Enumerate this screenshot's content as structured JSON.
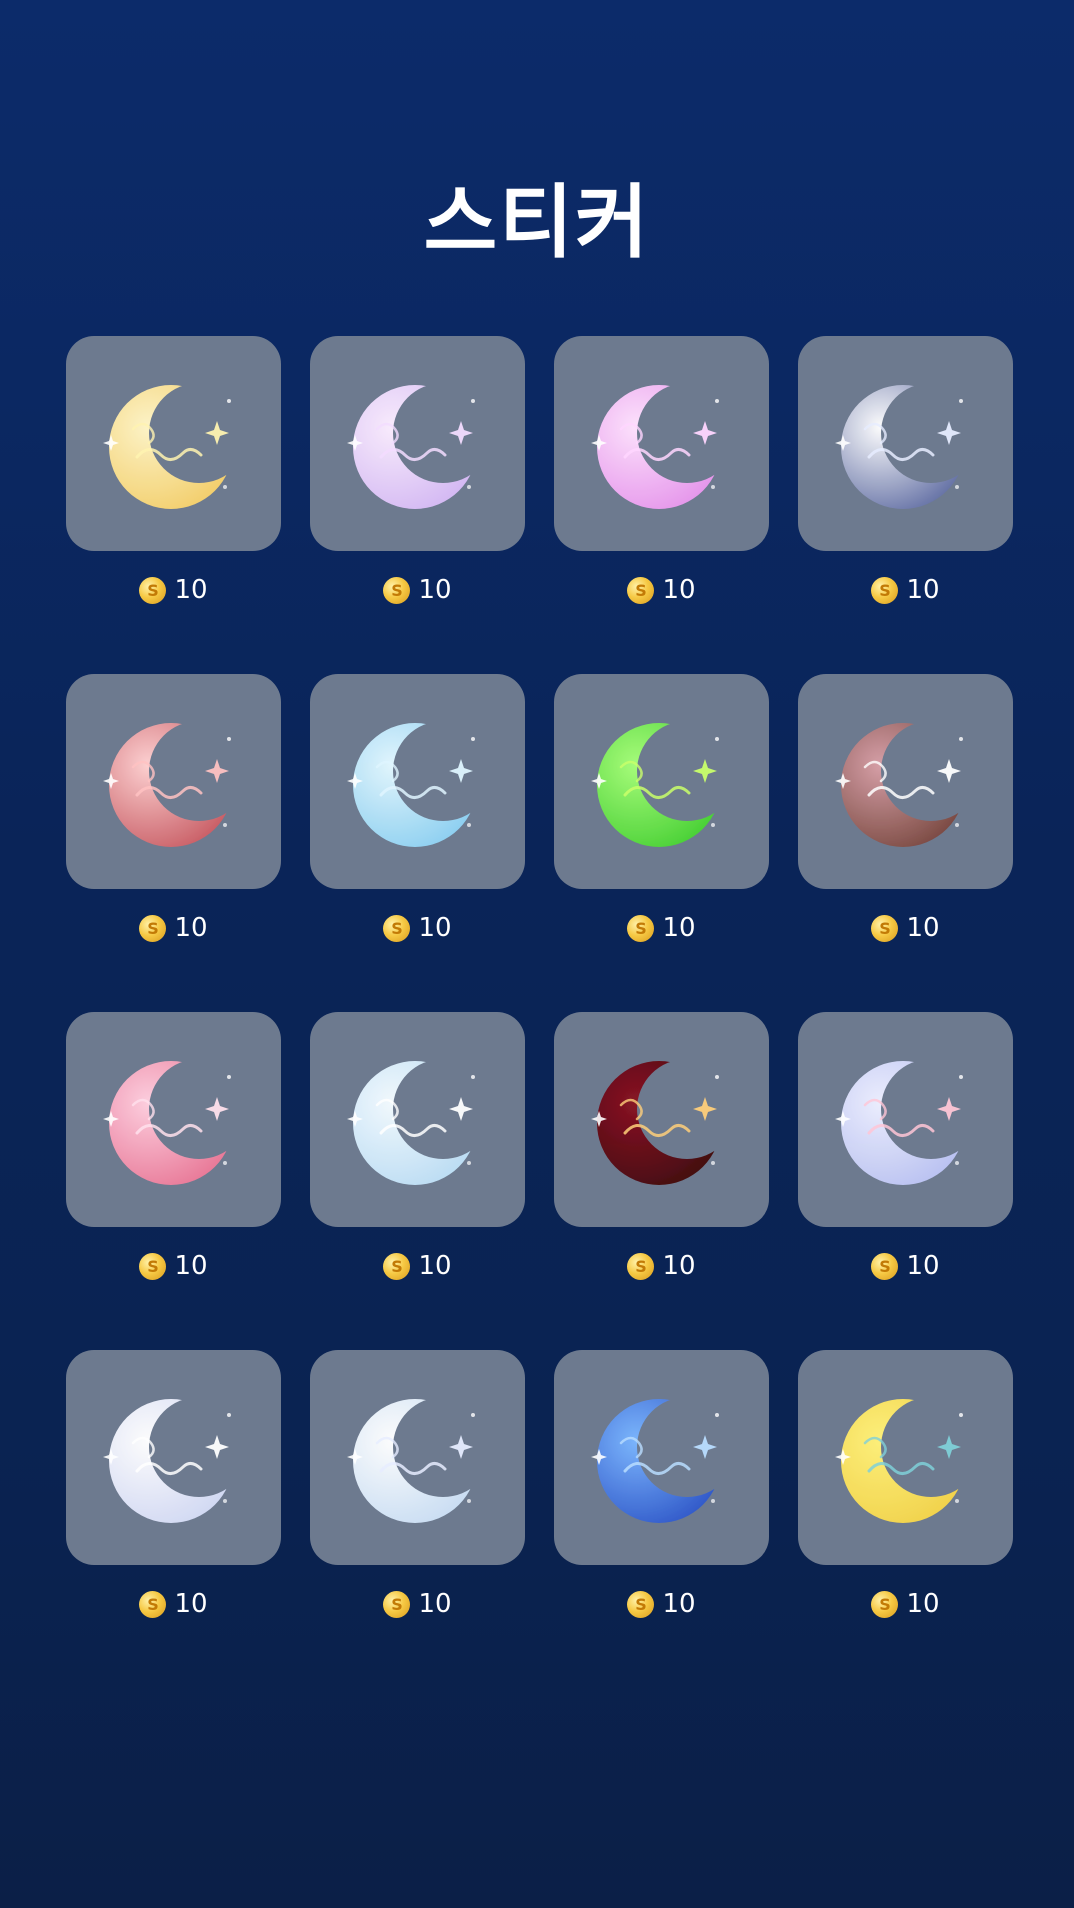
{
  "page_title": "스티커",
  "coin_symbol": "S",
  "stickers": [
    {
      "name": "moon-golden",
      "price": "10",
      "c1": "#fff6c8",
      "c2": "#f2c24a",
      "glow": "#fff3b0",
      "icon": "crescent-moon-icon"
    },
    {
      "name": "moon-lavender",
      "price": "10",
      "c1": "#fbeeff",
      "c2": "#c9a7f2",
      "glow": "#f3dcff",
      "icon": "crescent-moon-icon"
    },
    {
      "name": "moon-pink-violet",
      "price": "10",
      "c1": "#ffe3ff",
      "c2": "#e07be6",
      "glow": "#ffd6ff",
      "icon": "crescent-moon-icon"
    },
    {
      "name": "moon-navy-silver",
      "price": "10",
      "c1": "#ffffff",
      "c2": "#2e3f86",
      "glow": "#e6ecff",
      "icon": "crescent-moon-icon"
    },
    {
      "name": "moon-crimson",
      "price": "10",
      "c1": "#ffd2d2",
      "c2": "#b8343e",
      "glow": "#ffc2c2",
      "icon": "crescent-moon-icon"
    },
    {
      "name": "moon-sky-blue",
      "price": "10",
      "c1": "#e4f8ff",
      "c2": "#6fc3ee",
      "glow": "#dff5ff",
      "icon": "crescent-moon-icon"
    },
    {
      "name": "moon-neon-green",
      "price": "10",
      "c1": "#a8ff7a",
      "c2": "#27c21c",
      "glow": "#c9ff6a",
      "icon": "crescent-moon-icon"
    },
    {
      "name": "moon-chocolate",
      "price": "10",
      "c1": "#d8a0a8",
      "c2": "#5a2b1c",
      "glow": "#ffffff",
      "icon": "crescent-moon-icon"
    },
    {
      "name": "moon-rose",
      "price": "10",
      "c1": "#ffd0e0",
      "c2": "#e45a7e",
      "glow": "#ffe0ec",
      "icon": "crescent-moon-icon"
    },
    {
      "name": "moon-ice-blue",
      "price": "10",
      "c1": "#f4fbff",
      "c2": "#a9d5f3",
      "glow": "#ffffff",
      "icon": "crescent-moon-icon"
    },
    {
      "name": "moon-dark-ruby",
      "price": "10",
      "c1": "#8a1322",
      "c2": "#2a0308",
      "glow": "#ffcf7a",
      "icon": "crescent-moon-icon"
    },
    {
      "name": "moon-cherry-blossom",
      "price": "10",
      "c1": "#eef0ff",
      "c2": "#a9b3ef",
      "glow": "#ffc6d6",
      "icon": "crescent-moon-icon"
    },
    {
      "name": "moon-pearl",
      "price": "10",
      "c1": "#ffffff",
      "c2": "#c4cdf2",
      "glow": "#ffffff",
      "icon": "crescent-moon-icon"
    },
    {
      "name": "moon-silver-star",
      "price": "10",
      "c1": "#ffffff",
      "c2": "#b8d4f2",
      "glow": "#e6ecff",
      "icon": "crescent-moon-icon"
    },
    {
      "name": "moon-galaxy-blue",
      "price": "10",
      "c1": "#7cb7ff",
      "c2": "#1537b8",
      "glow": "#b9ddff",
      "icon": "crescent-moon-icon"
    },
    {
      "name": "moon-yellow-floral",
      "price": "10",
      "c1": "#fff27a",
      "c2": "#f0c93a",
      "glow": "#7fd0d8",
      "icon": "crescent-moon-icon"
    }
  ]
}
